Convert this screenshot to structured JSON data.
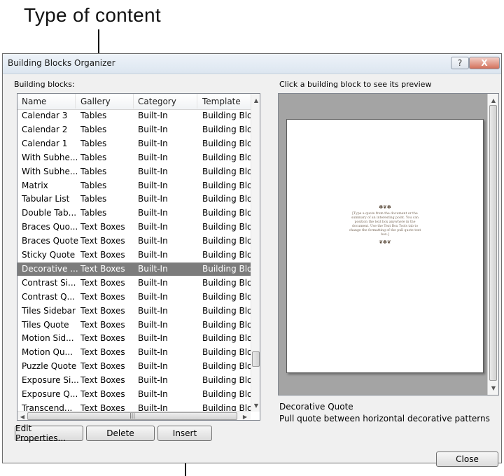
{
  "callout": {
    "text": "Type of content"
  },
  "window": {
    "title": "Building Blocks Organizer",
    "help_label": "?",
    "close_label": "X"
  },
  "list": {
    "label": "Building blocks:",
    "columns": [
      "Name",
      "Gallery",
      "Category",
      "Template"
    ],
    "rows": [
      {
        "name": "Calendar 3",
        "gallery": "Tables",
        "category": "Built-In",
        "template": "Building Blo..."
      },
      {
        "name": "Calendar 2",
        "gallery": "Tables",
        "category": "Built-In",
        "template": "Building Blo..."
      },
      {
        "name": "Calendar 1",
        "gallery": "Tables",
        "category": "Built-In",
        "template": "Building Blo..."
      },
      {
        "name": "With Subhe...",
        "gallery": "Tables",
        "category": "Built-In",
        "template": "Building Blo..."
      },
      {
        "name": "With Subhe...",
        "gallery": "Tables",
        "category": "Built-In",
        "template": "Building Blo..."
      },
      {
        "name": "Matrix",
        "gallery": "Tables",
        "category": "Built-In",
        "template": "Building Blo..."
      },
      {
        "name": "Tabular List",
        "gallery": "Tables",
        "category": "Built-In",
        "template": "Building Blo..."
      },
      {
        "name": "Double Tab...",
        "gallery": "Tables",
        "category": "Built-In",
        "template": "Building Blo..."
      },
      {
        "name": "Braces Quo...",
        "gallery": "Text Boxes",
        "category": "Built-In",
        "template": "Building Blo..."
      },
      {
        "name": "Braces Quote",
        "gallery": "Text Boxes",
        "category": "Built-In",
        "template": "Building Blo..."
      },
      {
        "name": "Sticky Quote",
        "gallery": "Text Boxes",
        "category": "Built-In",
        "template": "Building Blo..."
      },
      {
        "name": "Decorative ...",
        "gallery": "Text Boxes",
        "category": "Built-In",
        "template": "Building Blo...",
        "selected": true
      },
      {
        "name": "Contrast Si...",
        "gallery": "Text Boxes",
        "category": "Built-In",
        "template": "Building Blo..."
      },
      {
        "name": "Contrast Q...",
        "gallery": "Text Boxes",
        "category": "Built-In",
        "template": "Building Blo..."
      },
      {
        "name": "Tiles Sidebar",
        "gallery": "Text Boxes",
        "category": "Built-In",
        "template": "Building Blo..."
      },
      {
        "name": "Tiles Quote",
        "gallery": "Text Boxes",
        "category": "Built-In",
        "template": "Building Blo..."
      },
      {
        "name": "Motion Sid...",
        "gallery": "Text Boxes",
        "category": "Built-In",
        "template": "Building Blo..."
      },
      {
        "name": "Motion Qu...",
        "gallery": "Text Boxes",
        "category": "Built-In",
        "template": "Building Blo..."
      },
      {
        "name": "Puzzle Quote",
        "gallery": "Text Boxes",
        "category": "Built-In",
        "template": "Building Blo..."
      },
      {
        "name": "Exposure Si...",
        "gallery": "Text Boxes",
        "category": "Built-In",
        "template": "Building Blo..."
      },
      {
        "name": "Exposure Q...",
        "gallery": "Text Boxes",
        "category": "Built-In",
        "template": "Building Blo..."
      },
      {
        "name": "Transcend...",
        "gallery": "Text Boxes",
        "category": "Built-In",
        "template": "Building Blo..."
      }
    ]
  },
  "buttons": {
    "edit_properties": "Edit Properties...",
    "delete": "Delete",
    "insert": "Insert",
    "close": "Close"
  },
  "preview": {
    "label": "Click a building block to see its preview",
    "quote_text": "[Type a quote from the document or the summary of an interesting point. You can position the text box anywhere in the document. Use the Text Box Tools tab to change the formatting of the pull quote text box.]",
    "selected_name": "Decorative Quote",
    "selected_description": "Pull quote between horizontal decorative patterns"
  }
}
